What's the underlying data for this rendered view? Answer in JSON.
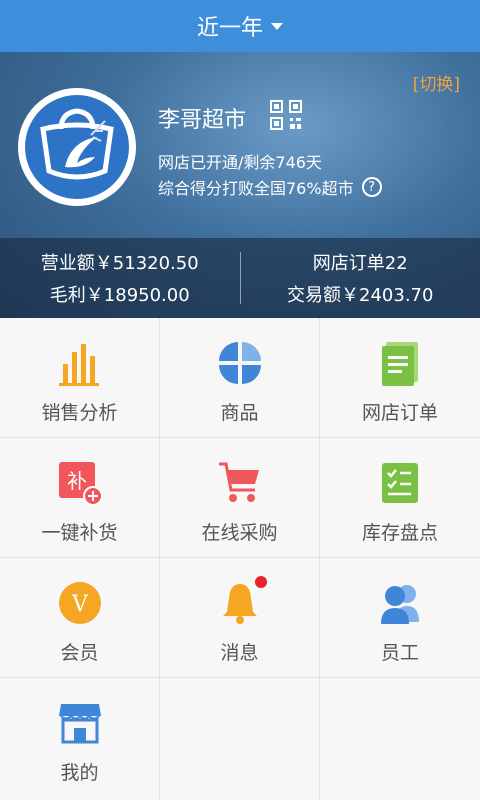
{
  "header": {
    "title": "近一年"
  },
  "store": {
    "switch_label": "[切换]",
    "name": "李哥超市",
    "status": "网店已开通/剩余746天",
    "score": "综合得分打败全国76%超市",
    "help_symbol": "?"
  },
  "stats": {
    "revenue": "营业额￥51320.50",
    "gross_profit": "毛利￥18950.00",
    "online_orders": "网店订单22",
    "transactions": "交易额￥2403.70"
  },
  "menu": [
    {
      "label": "销售分析",
      "icon": "bar-chart-icon",
      "color": "#f5a623"
    },
    {
      "label": "商品",
      "icon": "goods-grid-icon",
      "color": "#3f86d9"
    },
    {
      "label": "网店订单",
      "icon": "order-doc-icon",
      "color": "#7ac143"
    },
    {
      "label": "一键补货",
      "icon": "restock-icon",
      "color": "#f0565a"
    },
    {
      "label": "在线采购",
      "icon": "cart-icon",
      "color": "#f0565a"
    },
    {
      "label": "库存盘点",
      "icon": "checklist-icon",
      "color": "#7ac143"
    },
    {
      "label": "会员",
      "icon": "member-v-icon",
      "color": "#f5a623",
      "symbol": "V"
    },
    {
      "label": "消息",
      "icon": "bell-icon",
      "color": "#f5a623"
    },
    {
      "label": "员工",
      "icon": "staff-icon",
      "color": "#3f86d9"
    },
    {
      "label": "我的",
      "icon": "shop-icon",
      "color": "#3f86d9"
    }
  ],
  "restock_glyph": "补"
}
